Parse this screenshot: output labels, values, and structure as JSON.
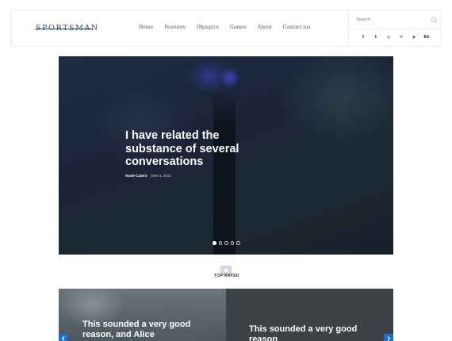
{
  "brand": {
    "logo": "SPORTSMAN"
  },
  "nav": {
    "items": [
      "Home",
      "Features",
      "Olympics",
      "Games",
      "About",
      "Contact me"
    ]
  },
  "search": {
    "placeholder": "Search"
  },
  "social": {
    "icons": [
      "facebook-icon",
      "twitter-icon",
      "instagram-icon",
      "email-icon",
      "pinterest-icon",
      "behance-icon"
    ],
    "glyphs": [
      "f",
      "t",
      "◎",
      "✉",
      "p",
      "Bē"
    ]
  },
  "hero": {
    "title": "I have related the substance of several conversations",
    "author": "Susie Castro",
    "date": "June 6, 2016",
    "slides": 5,
    "active_slide": 0
  },
  "top_rated": {
    "label": "TOP RATED"
  },
  "cards": [
    {
      "title": "This sounded a very good reason, and Alice"
    },
    {
      "title": "This sounded a very good reason"
    }
  ],
  "colors": {
    "brand": "#2f4c70",
    "arrow": "#1b6fd0",
    "card_dark": "#3d4246"
  }
}
